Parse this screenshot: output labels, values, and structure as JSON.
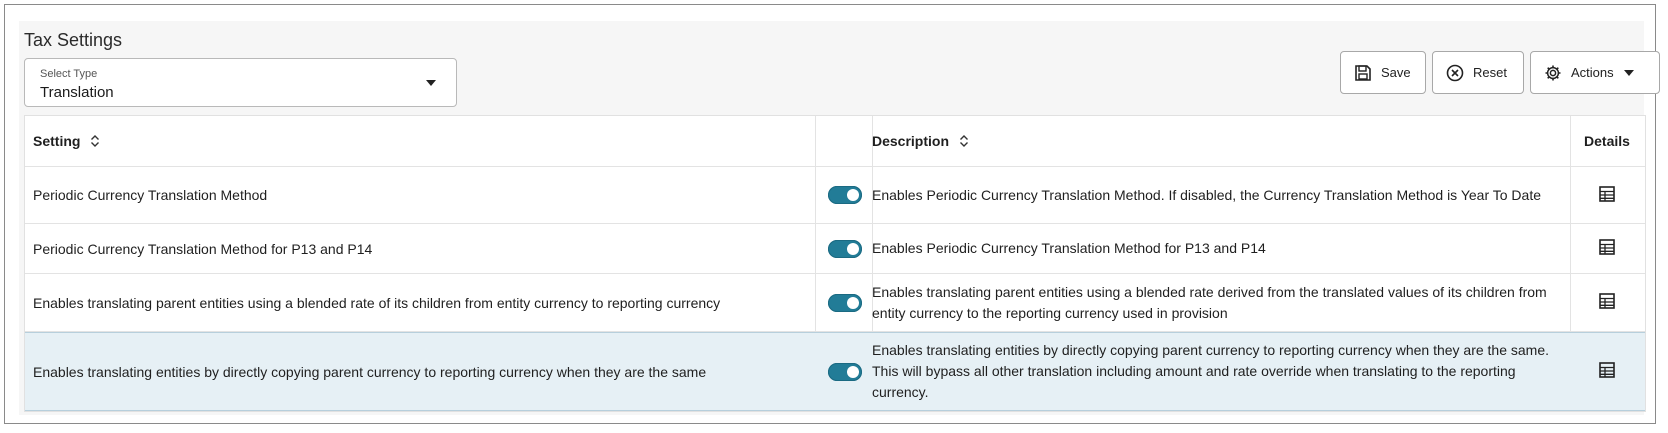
{
  "page": {
    "title": "Tax Settings"
  },
  "select_type": {
    "label": "Select Type",
    "value": "Translation"
  },
  "toolbar": {
    "save_label": "Save",
    "reset_label": "Reset",
    "actions_label": "Actions"
  },
  "table": {
    "columns": {
      "setting": "Setting",
      "description": "Description",
      "details": "Details"
    },
    "rows": [
      {
        "setting": "Periodic Currency Translation Method",
        "enabled": true,
        "description": "Enables Periodic Currency Translation Method. If disabled, the Currency Translation Method is Year To Date"
      },
      {
        "setting": "Periodic Currency Translation Method for P13 and P14",
        "enabled": true,
        "description": "Enables Periodic Currency Translation Method for P13 and P14"
      },
      {
        "setting": "Enables translating parent entities using a blended rate of its children from entity currency to reporting currency",
        "enabled": true,
        "description": "Enables translating parent entities using a blended rate derived from the translated values of its children from entity currency to the reporting currency used in provision"
      },
      {
        "setting": "Enables translating entities by directly copying parent currency to reporting currency when they are the same",
        "enabled": true,
        "description": "Enables translating entities by directly copying parent currency to reporting currency when they are the same. This will bypass all other translation including amount and rate override when translating to the reporting currency.",
        "selected": true
      }
    ]
  },
  "colors": {
    "toggle_on": "#227c97",
    "selected_row": "#e6f0f5"
  },
  "icons": {
    "save": "save-icon",
    "reset": "reset-icon",
    "actions": "gear-icon",
    "sort": "sort-icon",
    "details": "details-table-icon"
  }
}
